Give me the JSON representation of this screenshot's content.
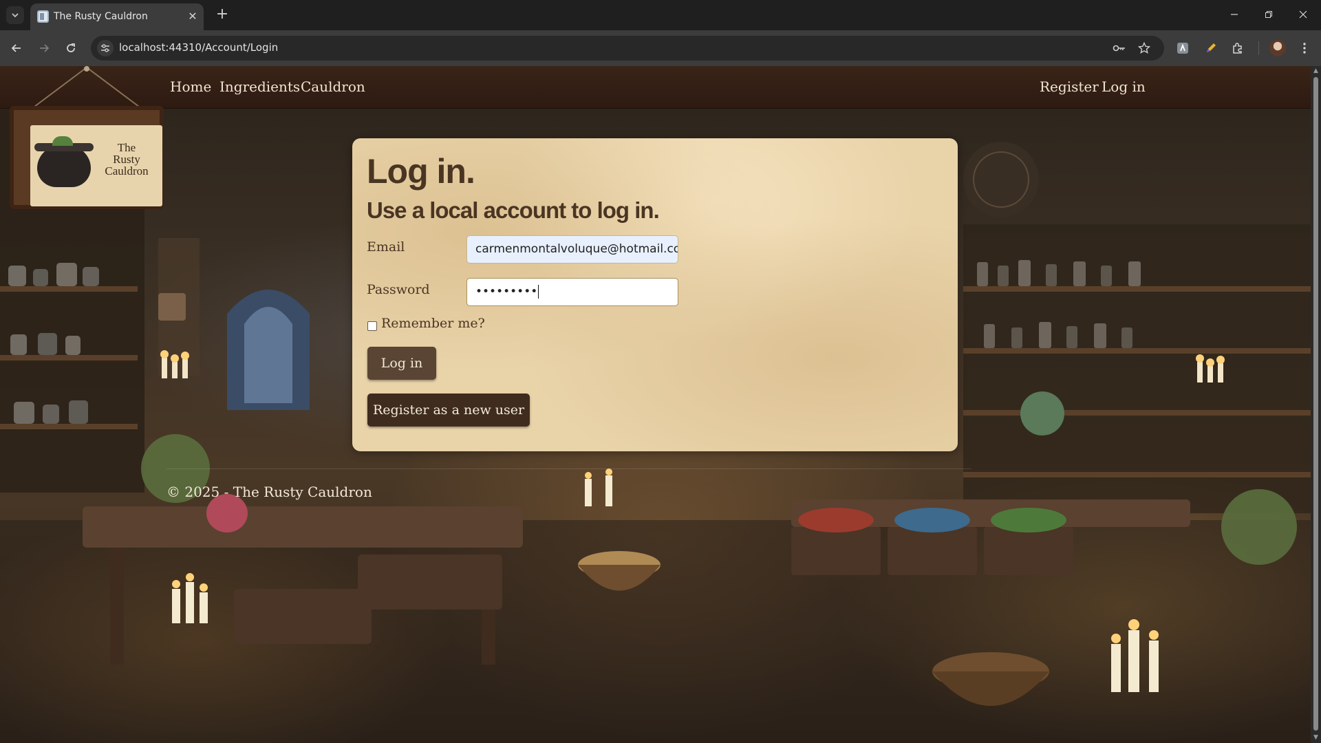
{
  "browser": {
    "tab_title": "The Rusty Cauldron",
    "url": "localhost:44310/Account/Login",
    "new_tab": "+",
    "tab_close": "✕"
  },
  "site": {
    "nav_left": [
      "Home",
      "Ingredients",
      "Cauldron"
    ],
    "nav_right": [
      "Register",
      "Log in"
    ],
    "logo_text": [
      "The",
      "Rusty",
      "Cauldron"
    ]
  },
  "login": {
    "title": "Log in.",
    "subtitle": "Use a local account to log in.",
    "email_label": "Email",
    "email_value": "carmenmontalvoluque@hotmail.co",
    "password_label": "Password",
    "password_value": "•••••••••",
    "remember_label": "Remember me?",
    "login_button": "Log in",
    "register_button": "Register as a new user"
  },
  "footer": {
    "text": "© 2025 - The Rusty Cauldron"
  }
}
